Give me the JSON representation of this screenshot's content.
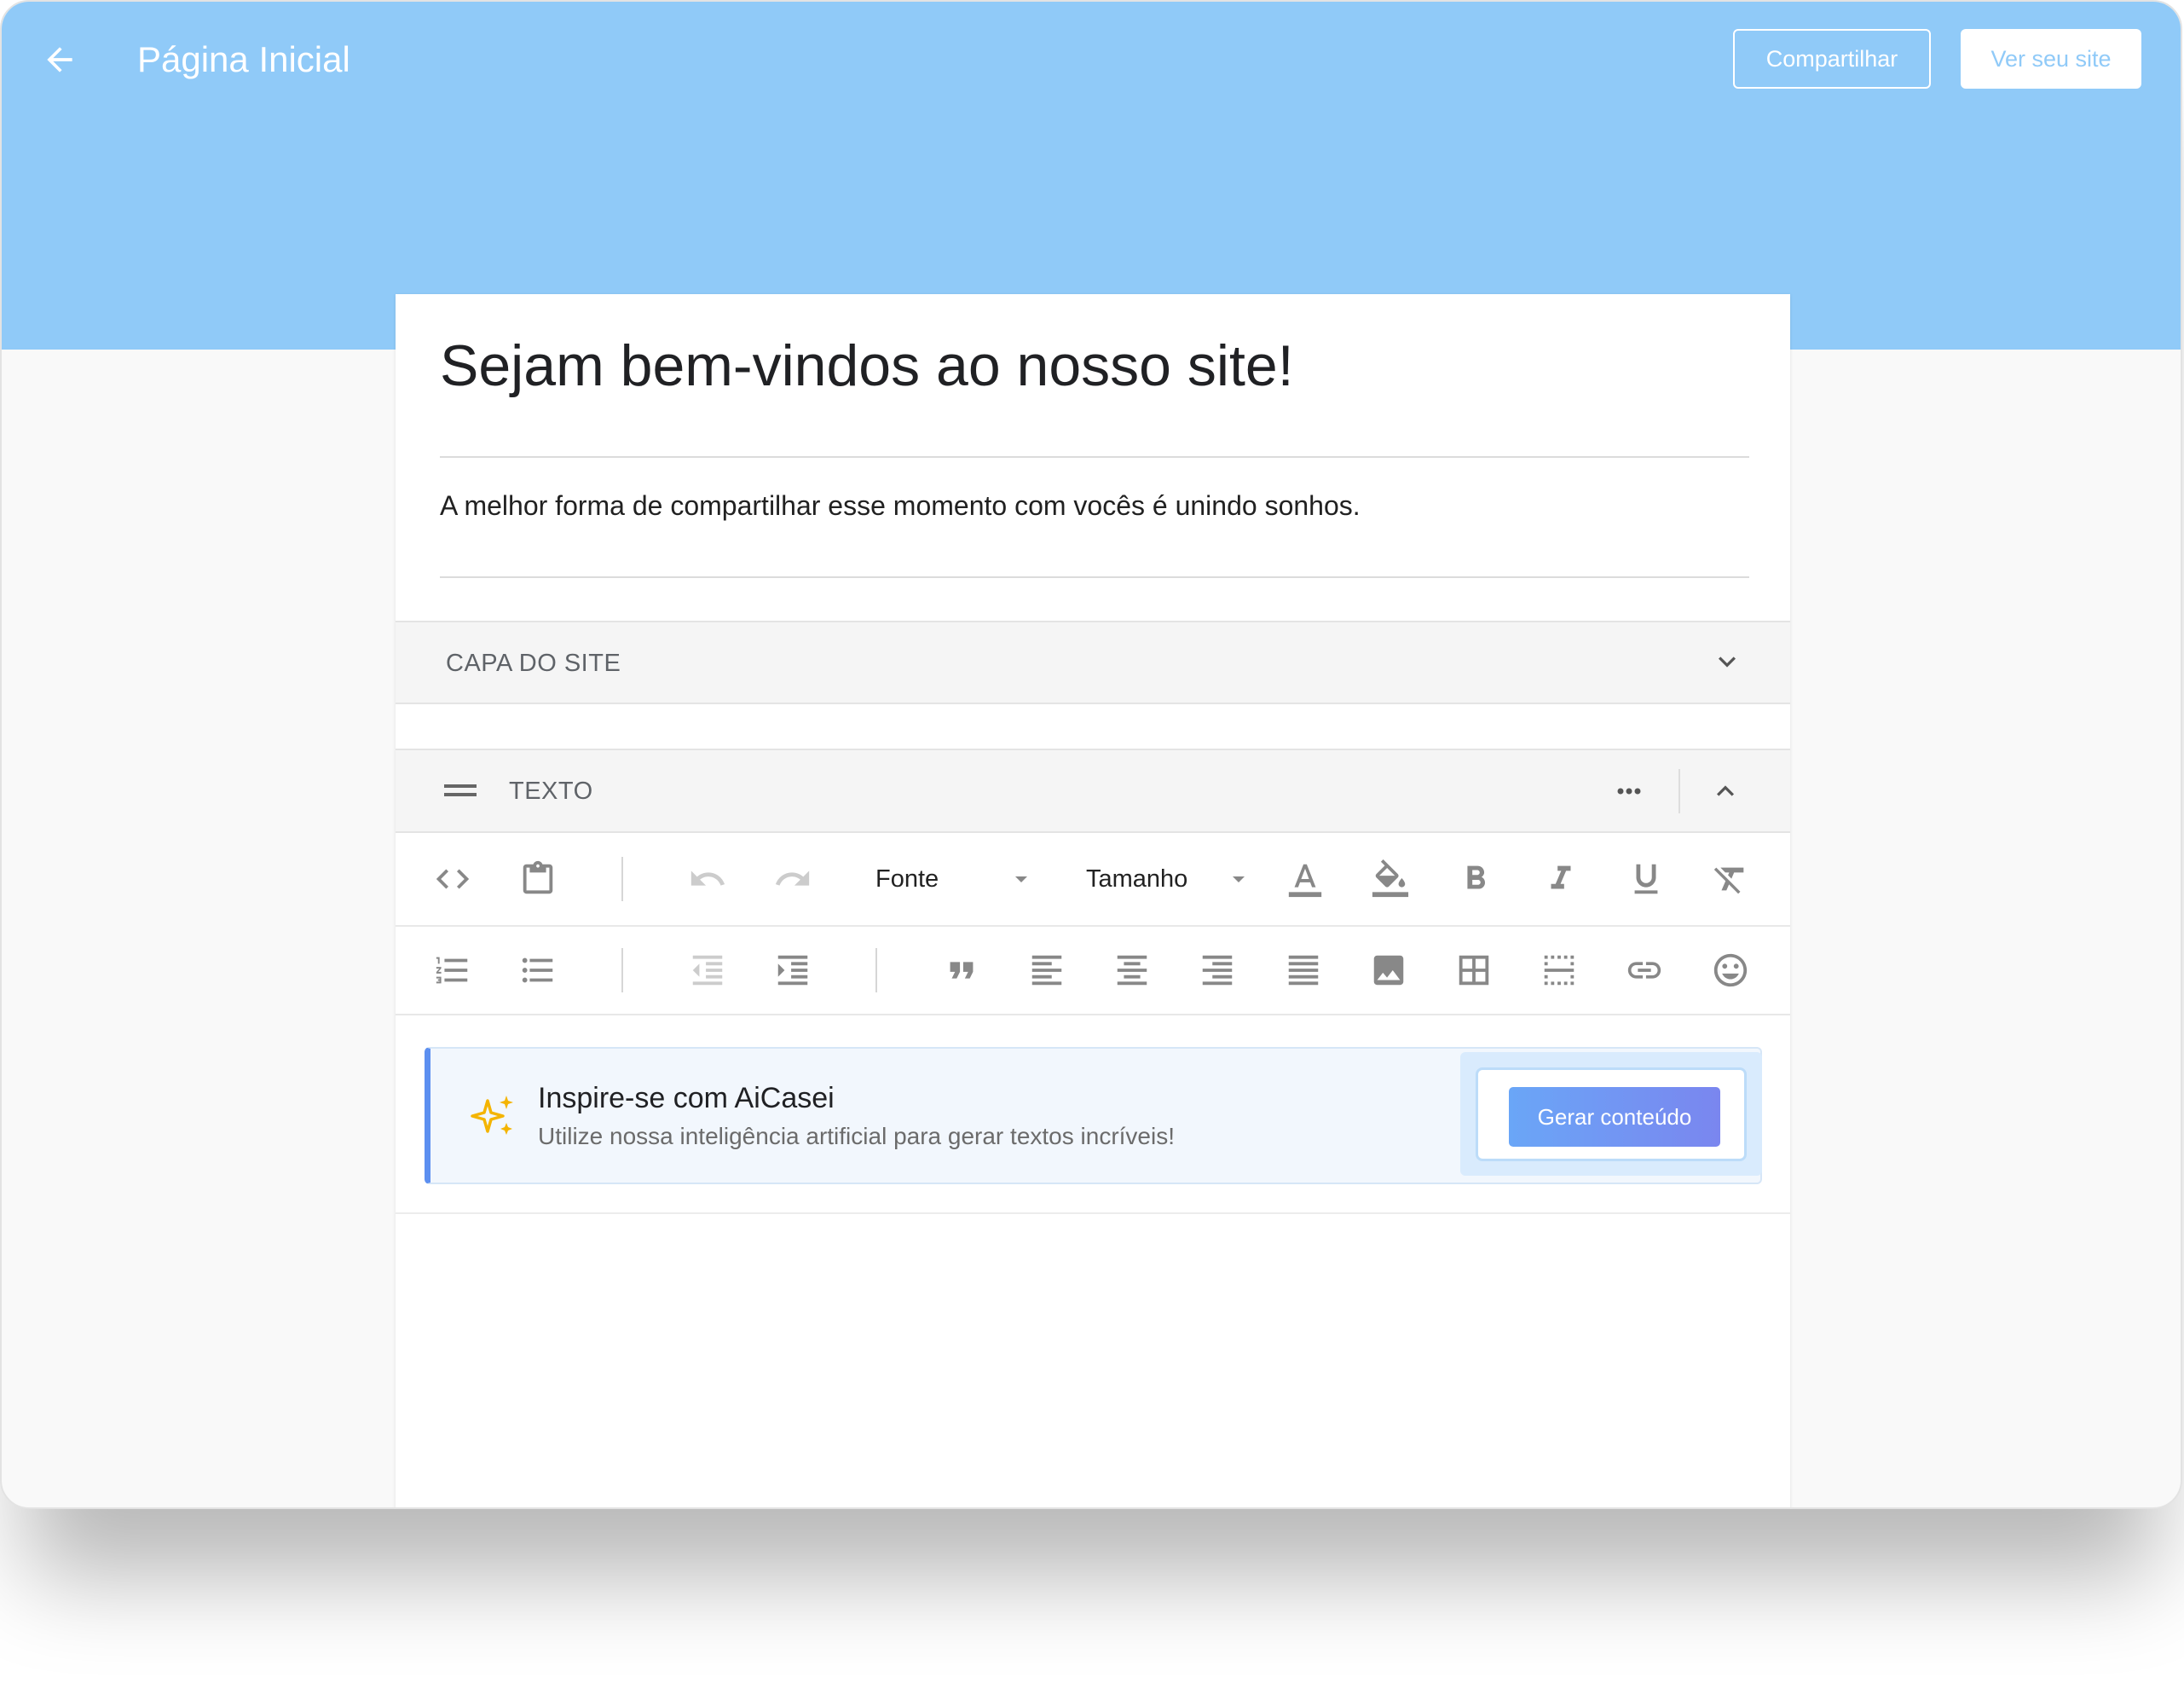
{
  "header": {
    "title": "Página Inicial",
    "share_label": "Compartilhar",
    "view_site_label": "Ver seu site"
  },
  "editor": {
    "headline": "Sejam bem-vindos ao nosso site!",
    "subtitle": "A melhor forma de compartilhar esse momento com vocês é unindo sonhos.",
    "sections": {
      "cover": {
        "label": "CAPA DO SITE",
        "icon": "chevron-down-icon"
      },
      "text": {
        "label": "TEXTO",
        "icons": [
          "drag-handle-icon",
          "more-icon",
          "chevron-up-icon"
        ]
      }
    },
    "toolbar": {
      "font_label": "Fonte",
      "size_label": "Tamanho",
      "row1_icons": [
        "code-view-icon",
        "paste-icon",
        "undo-icon",
        "redo-icon",
        "font-color-icon",
        "fill-color-icon",
        "bold-icon",
        "italic-icon",
        "underline-icon",
        "clear-format-icon"
      ],
      "row2_icons": [
        "numbered-list-icon",
        "bullet-list-icon",
        "outdent-icon",
        "indent-icon",
        "quote-icon",
        "align-left-icon",
        "align-center-icon",
        "align-right-icon",
        "justify-icon",
        "image-icon",
        "table-icon",
        "horizontal-rule-icon",
        "link-icon",
        "emoji-icon"
      ]
    },
    "ai_banner": {
      "title": "Inspire-se com AiCasei",
      "description": "Utilize nossa inteligência artificial para gerar textos incríveis!",
      "button_label": "Gerar conteúdo",
      "icon": "sparkles-icon"
    }
  },
  "colors": {
    "header_bg": "#90caf8",
    "accent_gradient_start": "#6aa6f7",
    "accent_gradient_end": "#7a86ef",
    "sparkle": "#f4b400",
    "toolbar_icon": "#888888"
  }
}
